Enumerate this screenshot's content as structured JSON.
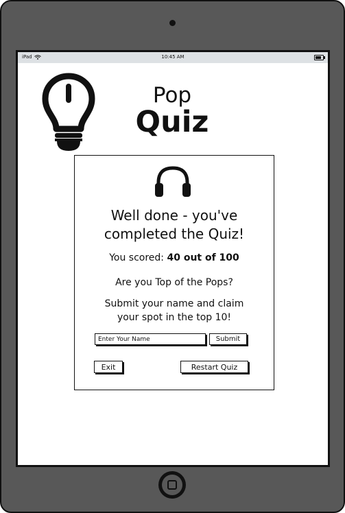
{
  "status_bar": {
    "device": "iPad",
    "time": "10:45 AM",
    "battery_level": 0.8
  },
  "header": {
    "title_line1": "Pop",
    "title_line2": "Quiz",
    "logo_icon": "lightbulb-icon"
  },
  "result": {
    "icon": "headphones-icon",
    "heading_line1": "Well done - you've",
    "heading_line2": "completed the Quiz!",
    "score_prefix": "You scored: ",
    "score_value": "40 out of 100",
    "question": "Are you Top of the Pops?",
    "prompt_line1": "Submit your name and claim",
    "prompt_line2": "your spot in the top 10!"
  },
  "form": {
    "name_placeholder": "Enter Your Name",
    "name_value": "",
    "submit_label": "Submit"
  },
  "actions": {
    "exit_label": "Exit",
    "restart_label": "Restart Quiz"
  },
  "colors": {
    "device_frame": "#585858",
    "status_bar": "#dde1e4",
    "ink": "#111111"
  }
}
